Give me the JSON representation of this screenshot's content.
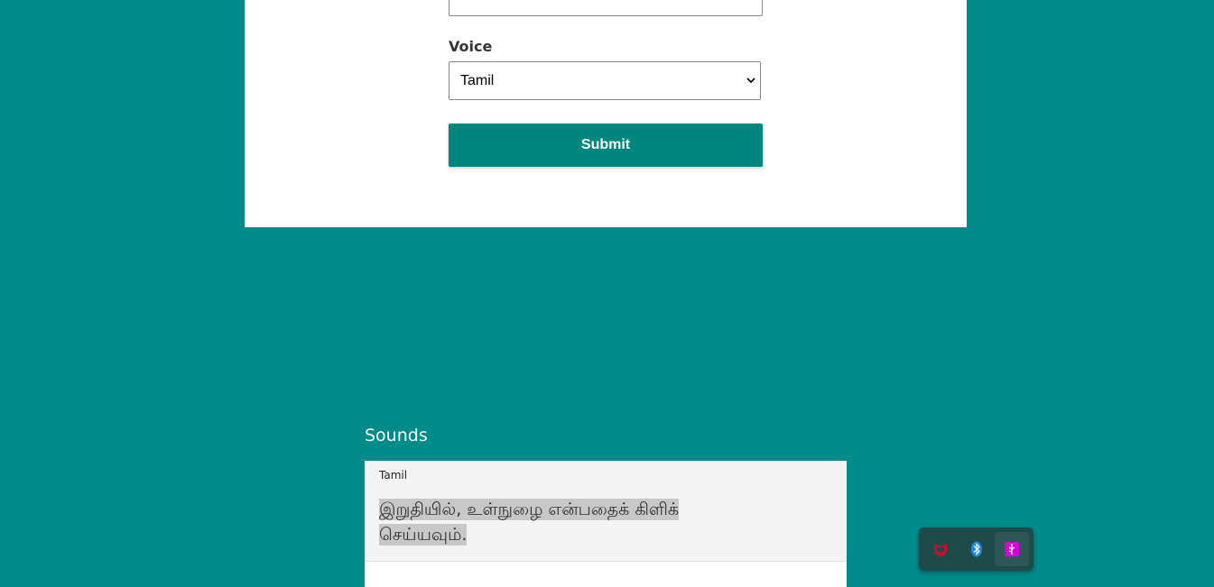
{
  "form": {
    "voice_label": "Voice",
    "voice_selected": "Tamil",
    "submit_label": "Submit"
  },
  "sounds": {
    "title": "Sounds",
    "items": [
      {
        "language": "Tamil",
        "text": "இறுதியில், உள்நுழை என்பதைக் கிளிக் செய்யவும்."
      }
    ]
  },
  "tray": {
    "icons": [
      {
        "name": "mcafee-icon",
        "color": "#c8102e"
      },
      {
        "name": "bluetooth-icon",
        "color": "#1e88e5"
      },
      {
        "name": "usb-icon",
        "color": "#d600d6"
      }
    ]
  }
}
